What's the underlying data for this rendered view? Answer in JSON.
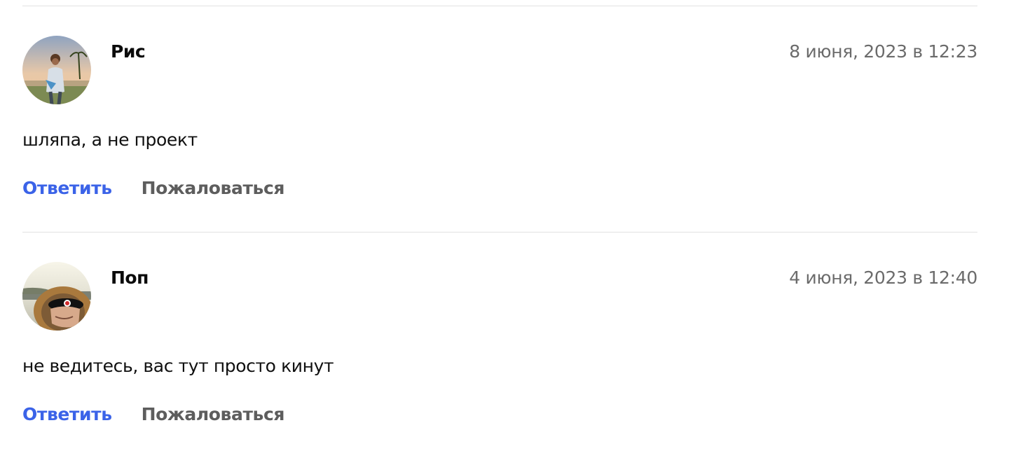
{
  "comments": [
    {
      "author": "Рис",
      "date": "8 июня, 2023 в 12:23",
      "text": "шляпа, а не проект",
      "actions": {
        "reply": "Ответить",
        "report": "Пожаловаться"
      },
      "avatar_icon": "user-photo-beach"
    },
    {
      "author": "Поп",
      "date": "4 июня, 2023 в 12:40",
      "text": "не ведитесь, вас тут просто кинут",
      "actions": {
        "reply": "Ответить",
        "report": "Пожаловаться"
      },
      "avatar_icon": "user-photo-hood"
    }
  ],
  "colors": {
    "reply": "#3b63e8",
    "report": "#5d5d5d",
    "date": "#6b6b6b",
    "divider": "#e1e1e1"
  }
}
